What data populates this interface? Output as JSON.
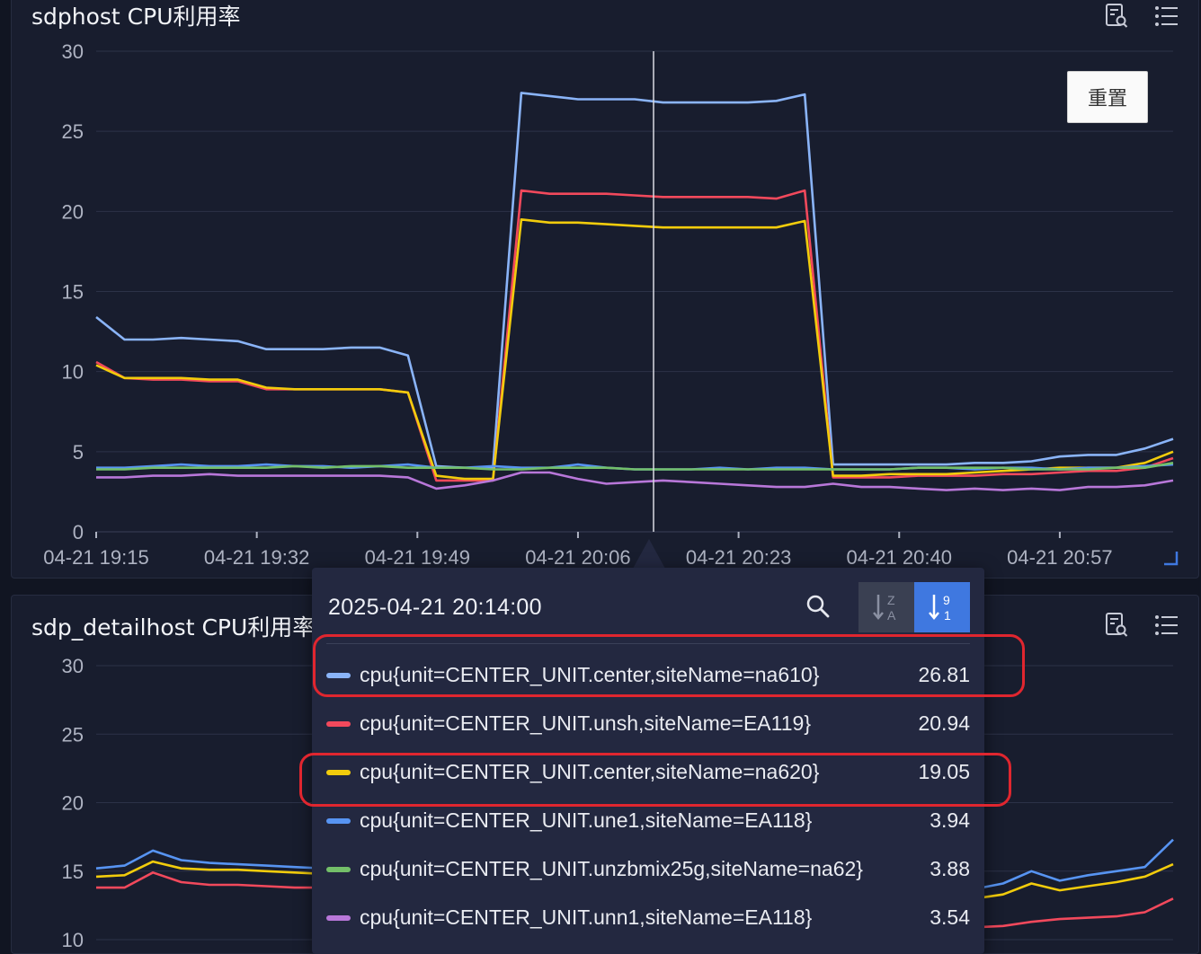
{
  "panel1": {
    "title": "sdphost CPU利用率",
    "reset_label": "重置",
    "icons": [
      "report-search-icon",
      "list-icon"
    ]
  },
  "panel2": {
    "title": "sdp_detailhost CPU利用率",
    "icons": [
      "report-search-icon",
      "list-icon"
    ]
  },
  "tooltip": {
    "time": "2025-04-21 20:14:00",
    "sort_options": [
      "alphabetical-sort",
      "numeric-sort"
    ],
    "active_sort": "numeric-sort",
    "rows": [
      {
        "label": "cpu{unit=CENTER_UNIT.center,siteName=na610}",
        "value": "26.81",
        "color": "#8ab4f8",
        "highlighted": true
      },
      {
        "label": "cpu{unit=CENTER_UNIT.unsh,siteName=EA119}",
        "value": "20.94",
        "color": "#f2495c",
        "highlighted": false
      },
      {
        "label": "cpu{unit=CENTER_UNIT.center,siteName=na620}",
        "value": "19.05",
        "color": "#f2cc0c",
        "highlighted": true
      },
      {
        "label": "cpu{unit=CENTER_UNIT.une1,siteName=EA118}",
        "value": "3.94",
        "color": "#5794f2",
        "highlighted": false
      },
      {
        "label": "cpu{unit=CENTER_UNIT.unzbmix25g,siteName=na62}",
        "value": "3.88",
        "color": "#73bf69",
        "highlighted": false
      },
      {
        "label": "cpu{unit=CENTER_UNIT.unn1,siteName=EA118}",
        "value": "3.54",
        "color": "#b877d9",
        "highlighted": false
      }
    ]
  },
  "chart_data": [
    {
      "type": "line",
      "title": "sdphost CPU利用率",
      "xlabel": "",
      "ylabel": "",
      "x": [
        "19:15",
        "19:18",
        "19:21",
        "19:24",
        "19:27",
        "19:30",
        "19:33",
        "19:36",
        "19:39",
        "19:42",
        "19:45",
        "19:48",
        "19:51",
        "19:54",
        "19:57",
        "20:00",
        "20:03",
        "20:06",
        "20:09",
        "20:12",
        "20:15",
        "20:18",
        "20:21",
        "20:24",
        "20:27",
        "20:30",
        "20:33",
        "20:36",
        "20:39",
        "20:42",
        "20:45",
        "20:48",
        "20:51",
        "20:54",
        "20:57",
        "21:00",
        "21:03",
        "21:06",
        "21:09"
      ],
      "xticks": [
        "04-21 19:15",
        "04-21 19:32",
        "04-21 19:49",
        "04-21 20:06",
        "04-21 20:23",
        "04-21 20:40",
        "04-21 20:57"
      ],
      "ylim": [
        0,
        30
      ],
      "yticks": [
        0,
        5,
        10,
        15,
        20,
        25,
        30
      ],
      "grid": true,
      "legend": "none",
      "crosshair_x": "20:14",
      "series": [
        {
          "name": "cpu{unit=CENTER_UNIT.center,siteName=na610}",
          "color": "#8ab4f8",
          "values": [
            13.4,
            12.0,
            12.0,
            12.1,
            12.0,
            11.9,
            11.4,
            11.4,
            11.4,
            11.5,
            11.5,
            11.0,
            4.1,
            4.0,
            4.0,
            27.4,
            27.2,
            27.0,
            27.0,
            27.0,
            26.8,
            26.8,
            26.8,
            26.8,
            26.9,
            27.3,
            4.2,
            4.2,
            4.2,
            4.2,
            4.2,
            4.3,
            4.3,
            4.4,
            4.7,
            4.8,
            4.8,
            5.2,
            5.8
          ]
        },
        {
          "name": "cpu{unit=CENTER_UNIT.unsh,siteName=EA119}",
          "color": "#f2495c",
          "values": [
            10.6,
            9.6,
            9.5,
            9.5,
            9.4,
            9.4,
            8.9,
            8.9,
            8.9,
            8.9,
            8.9,
            8.7,
            3.2,
            3.2,
            3.2,
            21.3,
            21.1,
            21.1,
            21.1,
            21.0,
            20.9,
            20.9,
            20.9,
            20.9,
            20.8,
            21.3,
            3.4,
            3.4,
            3.4,
            3.5,
            3.5,
            3.5,
            3.6,
            3.6,
            3.7,
            3.8,
            3.8,
            4.0,
            4.6
          ]
        },
        {
          "name": "cpu{unit=CENTER_UNIT.center,siteName=na620}",
          "color": "#f2cc0c",
          "values": [
            10.4,
            9.6,
            9.6,
            9.6,
            9.5,
            9.5,
            9.0,
            8.9,
            8.9,
            8.9,
            8.9,
            8.7,
            3.5,
            3.3,
            3.3,
            19.5,
            19.3,
            19.3,
            19.2,
            19.1,
            19.0,
            19.0,
            19.0,
            19.0,
            19.0,
            19.4,
            3.5,
            3.5,
            3.6,
            3.6,
            3.6,
            3.7,
            3.8,
            3.9,
            4.0,
            4.0,
            4.0,
            4.3,
            5.0
          ]
        },
        {
          "name": "cpu{unit=CENTER_UNIT.une1,siteName=EA118}",
          "color": "#5794f2",
          "values": [
            4.0,
            4.0,
            4.1,
            4.2,
            4.1,
            4.1,
            4.2,
            4.1,
            4.1,
            4.0,
            4.1,
            4.2,
            4.0,
            4.0,
            4.1,
            4.0,
            4.0,
            4.2,
            4.0,
            3.9,
            3.9,
            3.9,
            4.0,
            3.9,
            4.0,
            4.0,
            3.9,
            3.9,
            3.9,
            4.0,
            4.0,
            3.9,
            4.0,
            4.0,
            3.9,
            4.0,
            4.0,
            4.1,
            4.2
          ]
        },
        {
          "name": "cpu{unit=CENTER_UNIT.unzbmix25g,siteName=na62}",
          "color": "#73bf69",
          "values": [
            3.9,
            3.9,
            4.0,
            4.0,
            4.0,
            4.0,
            4.0,
            4.1,
            4.0,
            4.1,
            4.1,
            4.0,
            4.0,
            4.0,
            3.9,
            3.9,
            4.0,
            4.0,
            4.0,
            3.9,
            3.9,
            3.9,
            3.9,
            3.9,
            3.9,
            3.9,
            3.9,
            3.9,
            3.9,
            4.0,
            4.0,
            4.0,
            4.0,
            3.9,
            3.9,
            3.9,
            4.0,
            4.0,
            4.3
          ]
        },
        {
          "name": "cpu{unit=CENTER_UNIT.unn1,siteName=EA118}",
          "color": "#b877d9",
          "values": [
            3.4,
            3.4,
            3.5,
            3.5,
            3.6,
            3.5,
            3.5,
            3.5,
            3.5,
            3.5,
            3.5,
            3.4,
            2.7,
            2.9,
            3.2,
            3.7,
            3.7,
            3.3,
            3.0,
            3.1,
            3.2,
            3.1,
            3.0,
            2.9,
            2.8,
            2.8,
            3.0,
            2.8,
            2.8,
            2.7,
            2.6,
            2.7,
            2.6,
            2.7,
            2.6,
            2.8,
            2.8,
            2.9,
            3.2
          ]
        }
      ]
    },
    {
      "type": "line",
      "title": "sdp_detailhost CPU利用率",
      "xlabel": "",
      "ylabel": "",
      "x": [
        "19:15",
        "19:18",
        "19:21",
        "19:24",
        "19:27",
        "19:30",
        "19:33",
        "19:36",
        "19:39",
        "19:42",
        "19:45",
        "19:48",
        "19:51",
        "19:54",
        "19:57",
        "20:00",
        "20:03",
        "20:06",
        "20:09",
        "20:12",
        "20:15",
        "20:18",
        "20:21",
        "20:24",
        "20:27",
        "20:30",
        "20:33",
        "20:36",
        "20:39",
        "20:42",
        "20:45",
        "20:48",
        "20:51",
        "20:54",
        "20:57",
        "21:00",
        "21:03",
        "21:06",
        "21:09"
      ],
      "ylim": [
        10,
        30
      ],
      "yticks": [
        10,
        15,
        20,
        25,
        30
      ],
      "grid": true,
      "legend": "none",
      "series": [
        {
          "color": "#5794f2",
          "values": [
            15.2,
            15.4,
            16.5,
            15.8,
            15.6,
            15.5,
            15.4,
            15.3,
            15.2,
            15.1,
            15.0,
            15.0,
            15.1,
            15.0,
            15.0,
            14.8,
            14.7,
            14.6,
            14.6,
            14.5,
            14.5,
            14.4,
            14.3,
            14.3,
            14.2,
            14.1,
            14.0,
            14.0,
            13.9,
            13.8,
            13.8,
            13.7,
            14.1,
            15.0,
            14.3,
            14.7,
            15.0,
            15.3,
            17.3
          ]
        },
        {
          "color": "#f2cc0c",
          "values": [
            14.6,
            14.7,
            15.7,
            15.2,
            15.1,
            15.1,
            15.0,
            14.9,
            14.8,
            14.7,
            14.4,
            14.3,
            14.3,
            14.2,
            14.2,
            14.0,
            14.0,
            13.9,
            13.9,
            13.8,
            13.8,
            13.7,
            13.6,
            13.6,
            13.5,
            13.4,
            13.4,
            13.3,
            13.2,
            13.2,
            13.1,
            13.0,
            13.3,
            14.1,
            13.6,
            13.9,
            14.2,
            14.6,
            15.5
          ]
        },
        {
          "color": "#f2495c",
          "values": [
            13.8,
            13.8,
            14.9,
            14.2,
            14.0,
            14.0,
            13.9,
            13.8,
            13.8,
            13.7,
            13.5,
            13.5,
            13.5,
            13.4,
            13.4,
            13.3,
            13.2,
            13.1,
            13.1,
            13.0,
            12.9,
            12.8,
            12.6,
            12.5,
            12.3,
            12.1,
            11.9,
            11.7,
            11.5,
            11.2,
            11.0,
            10.9,
            11.0,
            11.3,
            11.5,
            11.6,
            11.7,
            12.0,
            13.0
          ]
        }
      ]
    }
  ]
}
